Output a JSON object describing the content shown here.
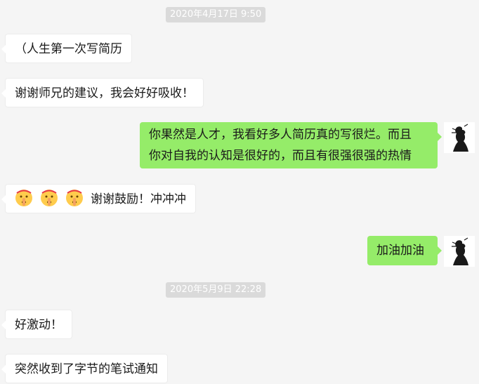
{
  "timestamps": [
    "2020年4月17日 9:50",
    "2020年5月9日 22:28"
  ],
  "messages": [
    {
      "side": "left",
      "text": "（人生第一次写简历"
    },
    {
      "side": "left",
      "text": "谢谢师兄的建议，我会好好吸收！"
    },
    {
      "side": "right",
      "lines": [
        "你果然是人才，我看好多人简历真的写很烂。而且",
        "你对自我的认知是很好的，而且有很强很强的热情"
      ]
    },
    {
      "side": "left",
      "emojis": [
        "shushing-face-icon",
        "shushing-face-icon",
        "shushing-face-icon"
      ],
      "text": "谢谢鼓励！冲冲冲"
    },
    {
      "side": "right",
      "text": "加油加油"
    },
    {
      "side": "left",
      "text": "好激动！"
    },
    {
      "side": "left",
      "text": "突然收到了字节的笔试通知"
    }
  ],
  "colors": {
    "background": "#f5f5f5",
    "bubble_self": "#95ec69",
    "bubble_other": "#ffffff",
    "timestamp_bg": "#dadada"
  }
}
